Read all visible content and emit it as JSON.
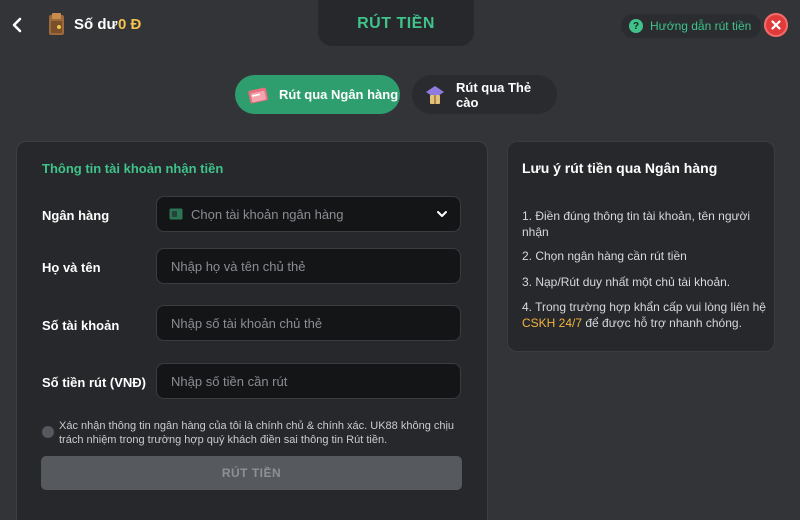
{
  "header": {
    "balance_label": "Số dư",
    "balance_value": "0 Đ",
    "title": "RÚT TIỀN",
    "guide_label": "Hướng dẫn rút tiền"
  },
  "tabs": {
    "bank_label": "Rút qua Ngân hàng",
    "card_label": "Rút qua Thẻ cào",
    "active": "bank"
  },
  "form": {
    "section_title": "Thông tin tài khoản nhận tiền",
    "bank": {
      "label": "Ngân hàng",
      "placeholder": "Chọn tài khoản ngân hàng"
    },
    "name": {
      "label": "Họ và tên",
      "placeholder": "Nhập họ và tên chủ thẻ"
    },
    "account": {
      "label": "Số tài khoản",
      "placeholder": "Nhập số tài khoản chủ thẻ"
    },
    "amount": {
      "label": "Số tiền rút (VNĐ)",
      "placeholder": "Nhập số tiền cần rút"
    },
    "confirm_text": "Xác nhận thông tin ngân hàng của tôi là chính chủ & chính xác. UK88 không chịu trách nhiệm trong trường hợp quý khách điền sai thông tin Rút tiền.",
    "submit_label": "RÚT TIỀN"
  },
  "notes": {
    "title": "Lưu ý rút tiền qua Ngân hàng",
    "item1": "1. Điền đúng thông tin tài khoản, tên người nhận",
    "item2": "2. Chọn ngân hàng cần rút tiền",
    "item3": "3. Nạp/Rút duy nhất một chủ tài khoản.",
    "item4_prefix": "4. Trong trường hợp khẩn cấp vui lòng liên hệ ",
    "item4_link": "CSKH 24/7",
    "item4_suffix": " để được hỗ trợ nhanh chóng."
  },
  "colors": {
    "accent_green": "#3fc38a",
    "balance_gold": "#f2c14e",
    "close_red": "#e03b3b",
    "link_orange": "#f2b33d"
  },
  "icons": {
    "back": "chevron-left-icon",
    "wallet": "wallet-icon",
    "guide": "question-icon",
    "close": "close-icon",
    "bank_tab": "bank-book-icon",
    "card_tab": "card-icon",
    "bank_field": "bank-card-icon",
    "dropdown": "chevron-down-icon"
  }
}
